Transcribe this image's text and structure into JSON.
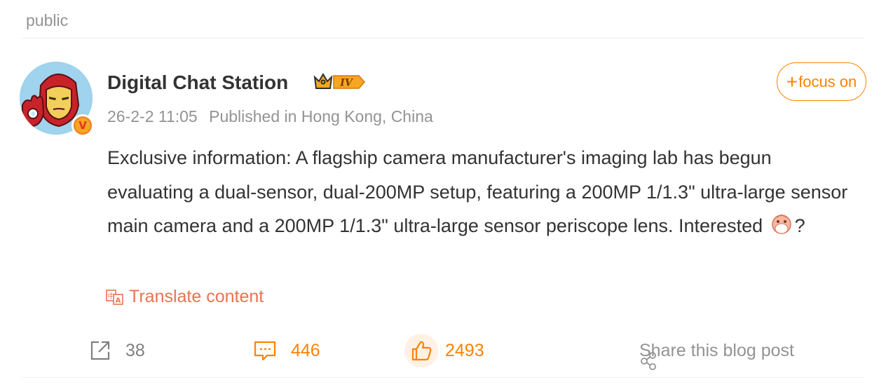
{
  "post": {
    "visibility": "public",
    "author": {
      "name": "Digital Chat Station",
      "level_badge": "IV",
      "verified": true
    },
    "meta": {
      "time": "26-2-2 11:05",
      "location": "Published in Hong Kong, China"
    },
    "follow_label": "focus on",
    "content_text": "Exclusive information: A flagship camera manufacturer's imaging lab has begun evaluating a dual-sensor, dual-200MP setup, featuring a 200MP 1/1.3\" ultra-large sensor main camera and a 200MP 1/1.3\" ultra-large sensor periscope lens. Interested ",
    "content_suffix": "?",
    "translate_label": "Translate content",
    "actions": {
      "repost_count": "38",
      "comment_count": "446",
      "like_count": "2493",
      "share_label": "Share this blog post"
    }
  },
  "colors": {
    "accent": "#ff8200",
    "translate": "#eb7350",
    "muted": "#939393",
    "text": "#333333"
  },
  "icons": [
    "repost-icon",
    "comment-icon",
    "like-icon",
    "share-icon",
    "translate-icon",
    "crown-icon",
    "verified-icon",
    "emoji-icon"
  ]
}
